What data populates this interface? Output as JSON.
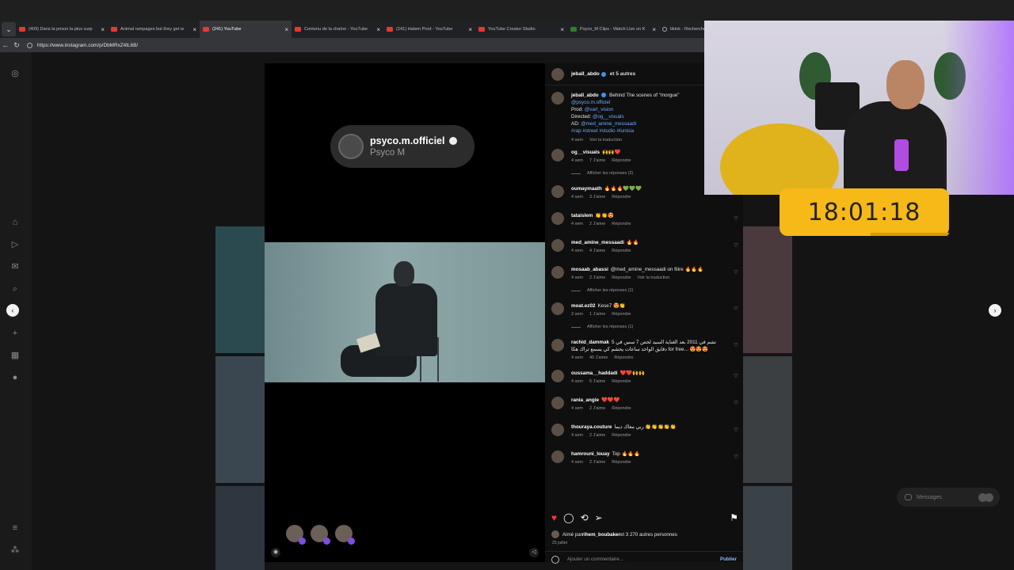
{
  "browser": {
    "tabs": [
      {
        "title": "(409) Dans la prison la plus surp",
        "fav": "youtube",
        "active": false
      },
      {
        "title": "Animal rampages but they get w",
        "fav": "youtube",
        "active": false
      },
      {
        "title": "(241) YouTube",
        "fav": "youtube",
        "active": true
      },
      {
        "title": "Contenu de la chaîne - YouTube",
        "fav": "youtube",
        "active": false
      },
      {
        "title": "(241) Hatem Prod - YouTube",
        "fav": "youtube",
        "active": false
      },
      {
        "title": "YouTube Creator Studio",
        "fav": "youtube",
        "active": false
      },
      {
        "title": "Psyco_M Clips - Watch Live on K",
        "fav": "green",
        "active": false
      },
      {
        "title": "tiktok - Recherche",
        "fav": "search",
        "active": false
      }
    ],
    "url": "https://www.instagram.com/p/DbMRxZ4tL6B/"
  },
  "post": {
    "collab_pill": {
      "handle": "psyco.m.officiel",
      "name": "Psyco M"
    },
    "header": {
      "user": "jeball_abdo",
      "others": "et 5 autres"
    },
    "caption": {
      "user": "jeball_abdo",
      "text": "Behind The scenes of \"morgue\"",
      "line2": "@psyco.m.officiel",
      "prod_label": "Prod: ",
      "prod": "@vart_vision",
      "directed_label": "Directed: ",
      "directed": "@og__visuals",
      "ad_label": "AD: ",
      "ad": "@med_amine_messaadi",
      "tags": "#rap #street #studio #tunisia",
      "time": "4 sem",
      "translate": "Voir la traduction"
    },
    "comments": [
      {
        "user": "og__visuals",
        "text": "🙌🙌❤️",
        "time": "4 sem",
        "likes": "7 J'aime",
        "reply": "Répondre",
        "replies": "Afficher les réponses (2)"
      },
      {
        "user": "oumaymaath",
        "text": "🔥🔥🔥💚💚💚",
        "time": "4 sem",
        "likes": "3 J'aime",
        "reply": "Répondre",
        "replies": ""
      },
      {
        "user": "tataislem",
        "text": "👏👏😍",
        "time": "4 sem",
        "likes": "2 J'aime",
        "reply": "Répondre",
        "replies": ""
      },
      {
        "user": "med_amine_messaadi",
        "text": "🔥🔥",
        "time": "4 sem",
        "likes": "4 J'aime",
        "reply": "Répondre",
        "replies": ""
      },
      {
        "user": "mosaab_abassi",
        "text": "@med_amine_messaadi on fiiire 🔥🔥🔥",
        "time": "4 sem",
        "likes": "2 J'aime",
        "reply": "Répondre",
        "translate": "Voir la traduction",
        "replies": "Afficher les réponses (1)"
      },
      {
        "user": "moat.ez02",
        "text": "Kese7 😍👏",
        "time": "3 sem",
        "likes": "1 J'aime",
        "reply": "Répondre",
        "replies": "Afficher les réponses (1)"
      },
      {
        "user": "rachid_dammak",
        "text": "نشم في 2011 بعد الغناية السيد لحص 7 سنين في 5 دقايق الواحد ساعات يحشم كي يسمع تراك هكا for free... 😍😍😍",
        "time": "4 sem",
        "likes": "40 J'aime",
        "reply": "Répondre",
        "replies": ""
      },
      {
        "user": "oussama__haddadi",
        "text": "❤️❤️🙌🙌",
        "time": "4 sem",
        "likes": "5 J'aime",
        "reply": "Répondre",
        "replies": ""
      },
      {
        "user": "rania_angie",
        "text": "❤️❤️❤️",
        "time": "4 sem",
        "likes": "2 J'aime",
        "reply": "Répondre",
        "replies": ""
      },
      {
        "user": "thouraya.couture",
        "text": "ربي معاك ديما 👏👏👏👏👏",
        "time": "4 sem",
        "likes": "2 J'aime",
        "reply": "Répondre",
        "replies": ""
      },
      {
        "user": "hamrouni_louay",
        "text": "Top 🔥🔥🔥",
        "time": "4 sem",
        "likes": "2 J'aime",
        "reply": "Répondre",
        "replies": ""
      }
    ],
    "likes": {
      "prefix": "Aimé par ",
      "user": "rihem_boubaker",
      "rest": " et 3 270 autres personnes"
    },
    "date": "25 juillet",
    "comment_placeholder": "Ajouter un commentaire...",
    "publish": "Publier"
  },
  "overlay": {
    "timer": "18:01:18",
    "messages": "Messages"
  },
  "colors": {
    "accent_like": "#ff3040",
    "link": "#6ca6ff",
    "timer_bg": "#f6b918"
  }
}
